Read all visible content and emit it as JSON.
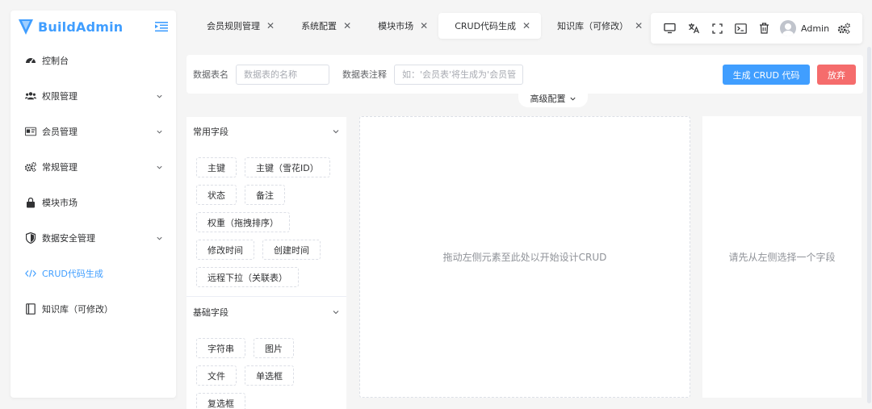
{
  "brand": {
    "name": "BuildAdmin",
    "accent": "#409eff"
  },
  "sidebar": {
    "items": [
      {
        "label": "控制台",
        "icon": "dashboard-icon",
        "expandable": false
      },
      {
        "label": "权限管理",
        "icon": "users-icon",
        "expandable": true
      },
      {
        "label": "会员管理",
        "icon": "id-card-icon",
        "expandable": true
      },
      {
        "label": "常规管理",
        "icon": "gears-icon",
        "expandable": true
      },
      {
        "label": "模块市场",
        "icon": "shopping-bag-icon",
        "expandable": false
      },
      {
        "label": "数据安全管理",
        "icon": "shield-icon",
        "expandable": true
      },
      {
        "label": "CRUD代码生成",
        "icon": "code-icon",
        "expandable": false,
        "active": true
      },
      {
        "label": "知识库（可修改）",
        "icon": "book-icon",
        "expandable": false
      }
    ]
  },
  "tabs": [
    {
      "label": "会员规则管理"
    },
    {
      "label": "系统配置"
    },
    {
      "label": "模块市场"
    },
    {
      "label": "CRUD代码生成",
      "active": true
    },
    {
      "label": "知识库（可修改）"
    }
  ],
  "toolbar": {
    "user": "Admin"
  },
  "form": {
    "table_name_label": "数据表名",
    "table_name_placeholder": "数据表的名称",
    "table_comment_label": "数据表注释",
    "table_comment_placeholder": "如：'会员表'将生成为'会员管",
    "generate_button": "生成 CRUD 代码",
    "discard_button": "放弃",
    "advanced_label": "高级配置"
  },
  "field_groups": [
    {
      "title": "常用字段",
      "fields": [
        "主键",
        "主键（雪花ID）",
        "状态",
        "备注",
        "权重（拖拽排序）",
        "修改时间",
        "创建时间",
        "远程下拉（关联表）"
      ]
    },
    {
      "title": "基础字段",
      "fields": [
        "字符串",
        "图片",
        "文件",
        "单选框",
        "复选框"
      ]
    }
  ],
  "design": {
    "placeholder": "拖动左侧元素至此处以开始设计CRUD"
  },
  "props": {
    "placeholder": "请先从左侧选择一个字段"
  },
  "colors": {
    "primary": "#409eff",
    "danger": "#f56c6c",
    "background": "#f5f5f5"
  }
}
